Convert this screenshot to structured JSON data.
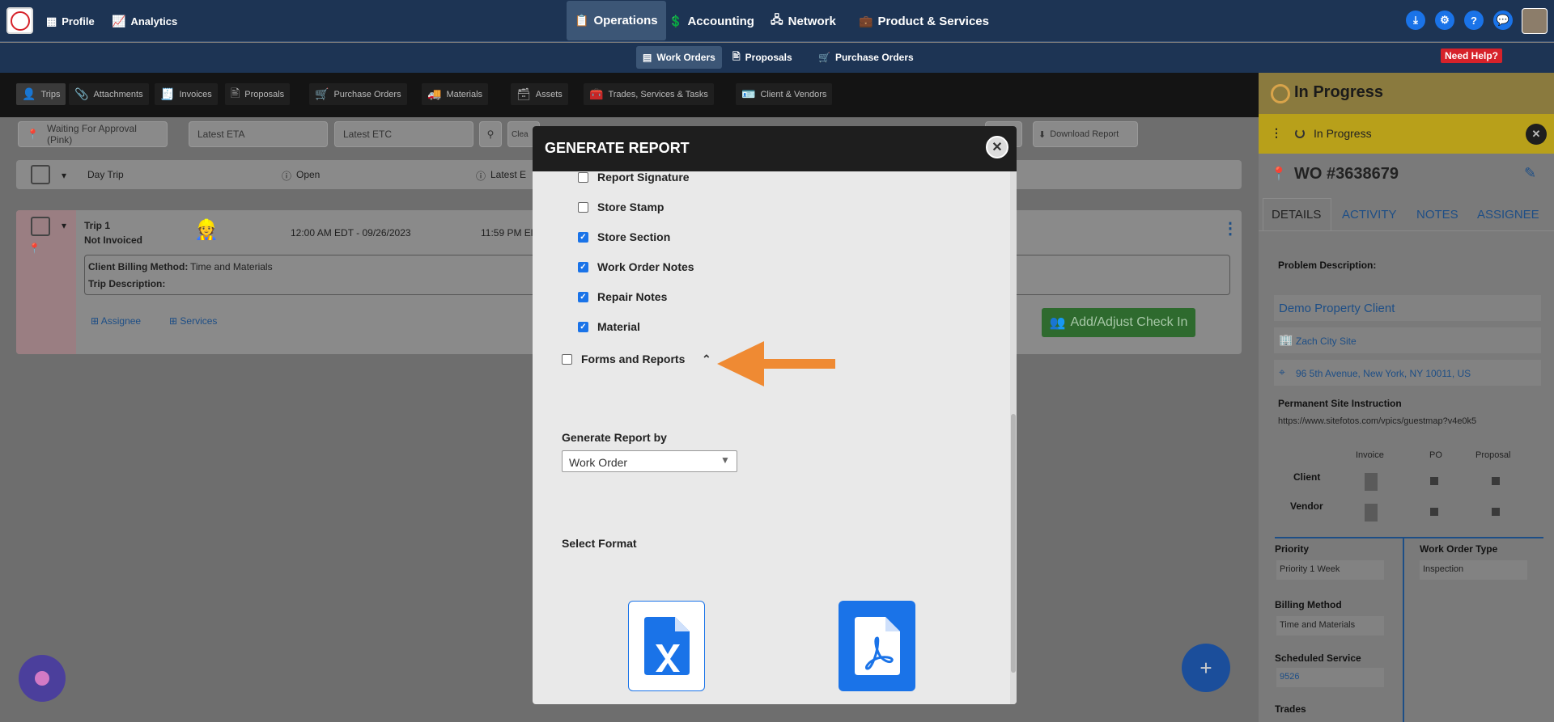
{
  "topnav": {
    "profile": "Profile",
    "analytics": "Analytics",
    "operations": "Operations",
    "accounting": "Accounting",
    "network": "Network",
    "products": "Product & Services"
  },
  "subnav": {
    "work_orders": "Work Orders",
    "proposals": "Proposals",
    "purchase_orders": "Purchase Orders",
    "need_help": "Need Help?"
  },
  "tabs": {
    "trips": "Trips",
    "attachments": "Attachments",
    "invoices": "Invoices",
    "proposals": "Proposals",
    "purchase_orders": "Purchase Orders",
    "materials": "Materials",
    "assets": "Assets",
    "trades": "Trades, Services & Tasks",
    "client_vendors": "Client & Vendors"
  },
  "filters": {
    "status": "Waiting For Approval (Pink)",
    "latest_eta": "Latest ETA",
    "latest_etc": "Latest ETC",
    "clear": "Clea",
    "download": "Download Report"
  },
  "header_row": {
    "day_trip": "Day Trip",
    "open": "Open",
    "latest": "Latest E"
  },
  "trip": {
    "name": "Trip 1",
    "invoice_status": "Not Invoiced",
    "start": "12:00 AM EDT - 09/26/2023",
    "end": "11:59 PM El",
    "billing_label": "Client Billing Method:",
    "billing_value": "Time and Materials",
    "description_label": "Trip Description:",
    "assignee": "Assignee",
    "services": "Services",
    "checkin_btn": "Add/Adjust Check In"
  },
  "right_panel": {
    "head_status": "In Progress",
    "status_bar": "In Progress",
    "wo_number": "WO #3638679",
    "tabs": [
      "DETAILS",
      "ACTIVITY",
      "NOTES",
      "ASSIGNEE"
    ],
    "problem_label": "Problem Description:",
    "client_name": "Demo Property Client",
    "site_name": "Zach City Site",
    "address": "96 5th Avenue, New York, NY 10011, US",
    "site_instr_label": "Permanent Site Instruction",
    "site_instr_value": "https://www.sitefotos.com/vpics/guestmap?v4e0k5",
    "matrix_cols": [
      "Invoice",
      "PO",
      "Proposal"
    ],
    "matrix_rows": [
      "Client",
      "Vendor"
    ],
    "priority_label": "Priority",
    "priority_value": "Priority 1 Week",
    "wo_type_label": "Work Order Type",
    "wo_type_value": "Inspection",
    "billing_label": "Billing Method",
    "billing_value": "Time and Materials",
    "sched_label": "Scheduled Service",
    "sched_value": "9526",
    "trades_label": "Trades"
  },
  "modal": {
    "title": "GENERATE REPORT",
    "options": [
      {
        "label": "Report Signature",
        "checked": false
      },
      {
        "label": "Store Stamp",
        "checked": false
      },
      {
        "label": "Store Section",
        "checked": true
      },
      {
        "label": "Work Order Notes",
        "checked": true
      },
      {
        "label": "Repair Notes",
        "checked": true
      },
      {
        "label": "Material",
        "checked": true
      }
    ],
    "forms_reports": "Forms and Reports",
    "generate_by_label": "Generate Report by",
    "generate_by_value": "Work Order",
    "select_format": "Select Format",
    "formats": [
      "excel-icon",
      "pdf-icon"
    ]
  },
  "colors": {
    "nav_bg": "#1d3454",
    "accent_blue": "#1a73e8",
    "arrow": "#ef8a33",
    "checkin_green": "#3a9b3a",
    "status_yellow": "#f2d600",
    "help_red": "#d6222a"
  }
}
